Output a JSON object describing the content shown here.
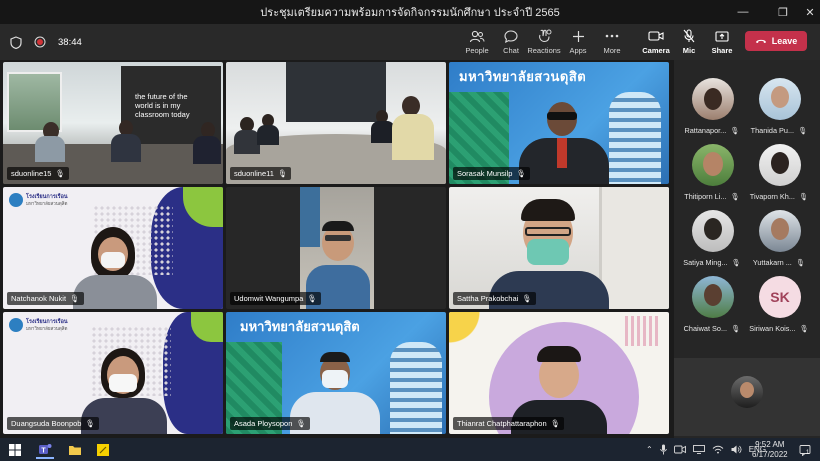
{
  "window": {
    "title": "ประชุมเตรียมความพร้อมการจัดกิจกรรมนักศึกษา ประจำปี 2565"
  },
  "toolbar": {
    "timer": "38:44",
    "people": "People",
    "chat": "Chat",
    "reactions": "Reactions",
    "apps": "Apps",
    "more": "More",
    "camera": "Camera",
    "mic": "Mic",
    "share": "Share",
    "leave": "Leave"
  },
  "tiles": [
    {
      "name": "sduonline15",
      "poster": "the future of the world is in my classroom today"
    },
    {
      "name": "sduonline11"
    },
    {
      "name": "Sorasak Munsilp",
      "banner": "มหาวิทยาลัยสวนดุสิต"
    },
    {
      "name": "Natchanok Nukit",
      "logo": "โรงเรียนการเรือน",
      "logo_sub": "มหาวิทยาลัยสวนดุสิต"
    },
    {
      "name": "Udomwit Wangumpa"
    },
    {
      "name": "Sattha Prakobchai"
    },
    {
      "name": "Duangsuda Boonpob",
      "logo": "โรงเรียนการเรือน",
      "logo_sub": "มหาวิทยาลัยสวนดุสิต"
    },
    {
      "name": "Asada Ploysopon",
      "banner": "มหาวิทยาลัยสวนดุสิต"
    },
    {
      "name": "Thianrat Chatphattaraphon"
    }
  ],
  "roster": [
    {
      "name": "Rattanapor..."
    },
    {
      "name": "Thanida Pu..."
    },
    {
      "name": "Thitiporn Li..."
    },
    {
      "name": "Tivaporn Kh..."
    },
    {
      "name": "Satiya Ming..."
    },
    {
      "name": "Yuttakarn ..."
    },
    {
      "name": "Chaiwat So..."
    },
    {
      "name": "Siriwan Kois...",
      "initials": "SK"
    }
  ],
  "taskbar": {
    "language": "ENG",
    "time": "9:52 AM",
    "date": "6/17/2022",
    "notifications": "1"
  },
  "colors": {
    "leave": "#c4314b",
    "accent": "#6264a7"
  }
}
